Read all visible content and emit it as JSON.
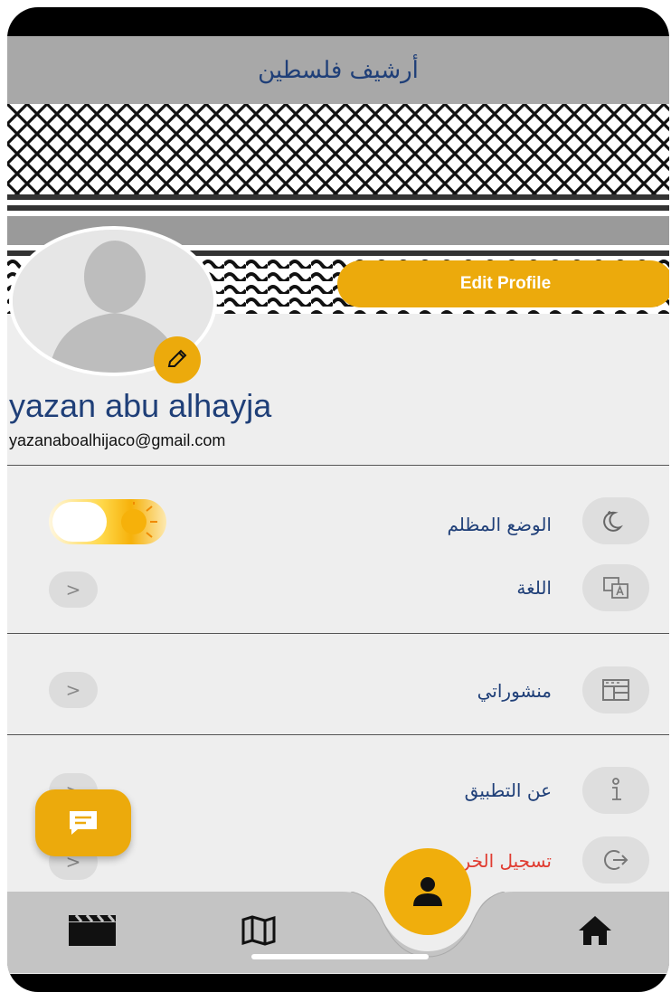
{
  "appbar": {
    "title": "أرشيف فلسطين"
  },
  "profile": {
    "edit_profile_label": "Edit Profile",
    "name": "yazan abu alhayja",
    "email": "yazanaboalhijaco@gmail.com"
  },
  "settings": {
    "dark_mode_label": "الوضع المظلم",
    "dark_mode_enabled": false,
    "language_label": "اللغة",
    "my_posts_label": "منشوراتي",
    "about_label": "عن التطبيق",
    "logout_label": "تسجيل الخروج"
  },
  "icons": {
    "dark_mode": "moon-stars-icon",
    "language": "translate-icon",
    "my_posts": "posts-icon",
    "about": "info-icon",
    "logout": "logout-icon",
    "chevron": ">",
    "fab": "message-icon",
    "nav": [
      "clapperboard-icon",
      "map-icon",
      "person-icon",
      "home-icon"
    ]
  },
  "colors": {
    "accent": "#ecaa0c",
    "title": "#1f3f78",
    "logout": "#e03c31",
    "appbar": "#a8a8a8",
    "nav": "#c4c4c4"
  },
  "bottom_nav": {
    "active_index": 2
  }
}
